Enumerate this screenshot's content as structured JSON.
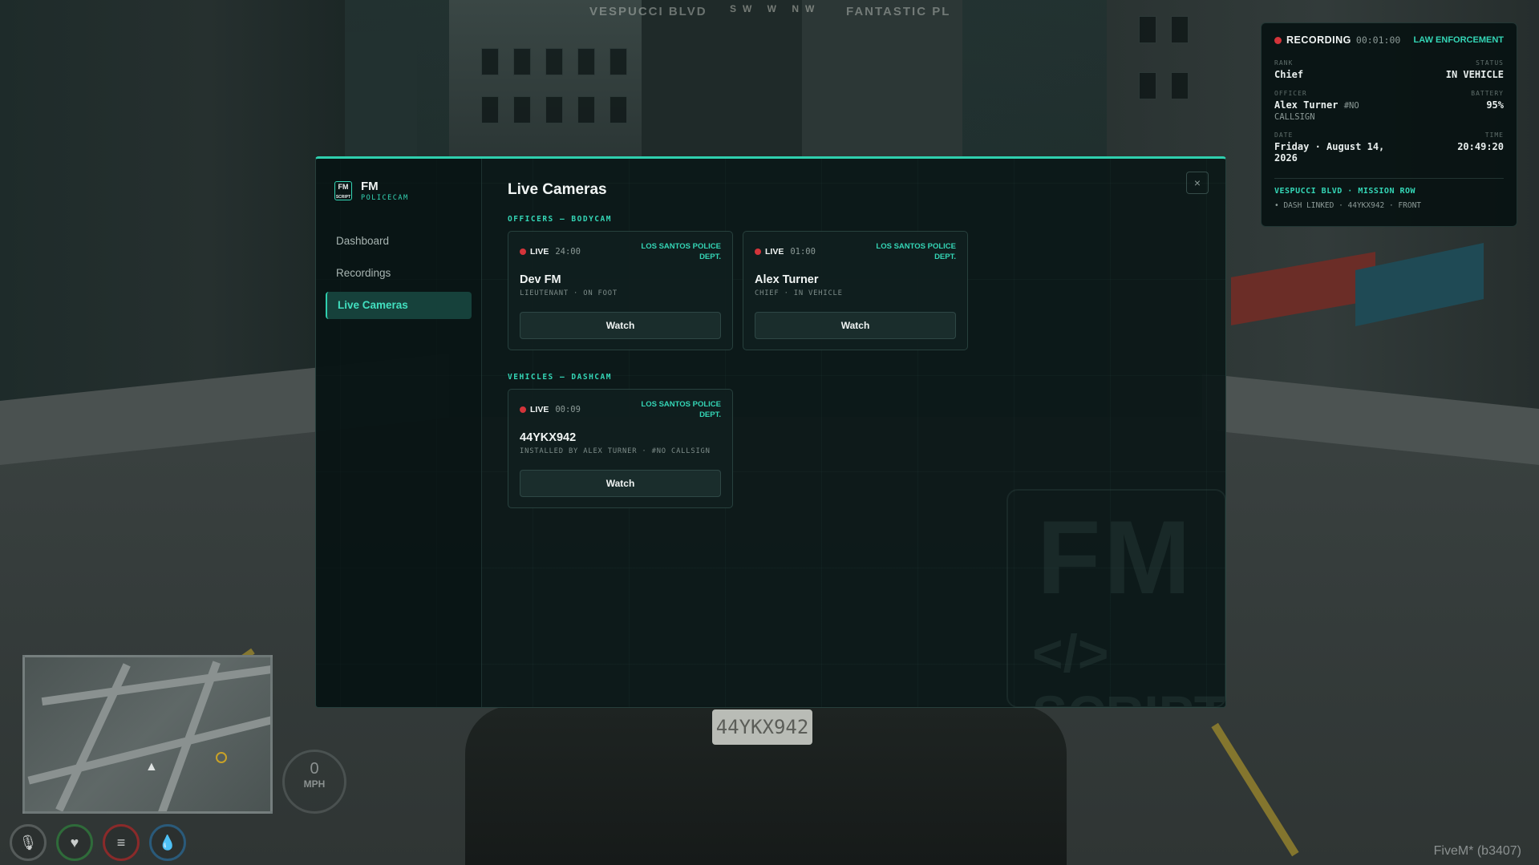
{
  "background": {
    "street_left": "VESPUCCI BLVD",
    "compass": "SW  W  NW",
    "street_right": "FANTASTIC PL",
    "plate": "44YKX942",
    "speed_value": "0",
    "speed_unit": "MPH",
    "client_version": "FiveM* (b3407)"
  },
  "recording": {
    "label": "RECORDING",
    "timer": "00:01:00",
    "agency": "LAW ENFORCEMENT",
    "rank_key": "RANK",
    "rank": "Chief",
    "status_key": "STATUS",
    "status": "IN VEHICLE",
    "officer_key": "OFFICER",
    "officer_name": "Alex Turner",
    "officer_callsign": "#NO CALLSIGN",
    "battery_key": "BATTERY",
    "battery": "95%",
    "date_key": "DATE",
    "date": "Friday · August 14, 2026",
    "time_key": "TIME",
    "time": "20:49:20",
    "location": "VESPUCCI BLVD · MISSION ROW",
    "dash_link": "• DASH LINKED · 44YKX942 · FRONT"
  },
  "sidebar": {
    "brand_logo": "FM SCRIPT",
    "brand_name": "FM",
    "brand_sub": "POLICECAM",
    "items": [
      {
        "label": "Dashboard"
      },
      {
        "label": "Recordings"
      },
      {
        "label": "Live Cameras"
      }
    ]
  },
  "main": {
    "title": "Live Cameras",
    "close": "×",
    "officers_section": "OFFICERS — BODYCAM",
    "vehicles_section": "VEHICLES — DASHCAM",
    "officers": [
      {
        "live": "LIVE",
        "time": "24:00",
        "agency": "LOS SANTOS POLICE DEPT.",
        "name": "Dev FM",
        "meta": "LIEUTENANT · ON FOOT",
        "action": "Watch"
      },
      {
        "live": "LIVE",
        "time": "01:00",
        "agency": "LOS SANTOS POLICE DEPT.",
        "name": "Alex Turner",
        "meta": "CHIEF · IN VEHICLE",
        "action": "Watch"
      }
    ],
    "vehicles": [
      {
        "live": "LIVE",
        "time": "00:09",
        "agency": "LOS SANTOS POLICE DEPT.",
        "name": "44YKX942",
        "meta": "INSTALLED BY ALEX TURNER · #NO CALLSIGN",
        "action": "Watch"
      }
    ]
  },
  "watermark": {
    "top": "FM",
    "bottom": "SCRIPT"
  },
  "colors": {
    "accent": "#2fcfae",
    "live_dot": "#d3343a",
    "panel_bg": "#0c1818"
  }
}
